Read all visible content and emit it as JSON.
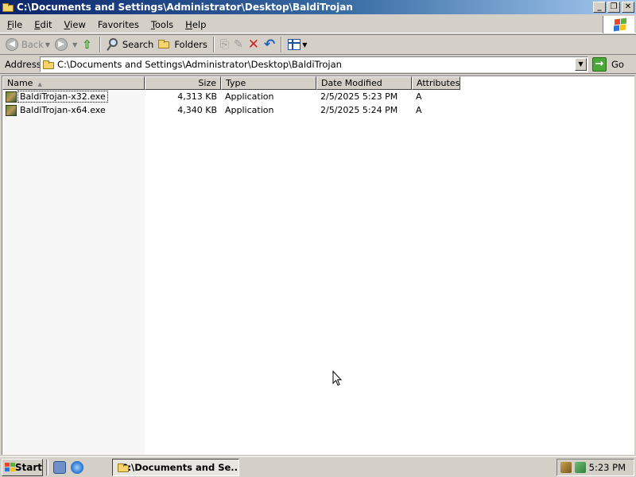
{
  "window": {
    "title": "C:\\Documents and Settings\\Administrator\\Desktop\\BaldiTrojan",
    "buttons": {
      "minimize": "_",
      "restore": "❐",
      "close": "✕"
    }
  },
  "menubar": {
    "items": [
      {
        "label": "File",
        "accel": "F",
        "rest": "ile"
      },
      {
        "label": "Edit",
        "accel": "E",
        "rest": "dit"
      },
      {
        "label": "View",
        "accel": "V",
        "rest": "iew"
      },
      {
        "label": "Favorites",
        "accel": "F",
        "rest": "avorites"
      },
      {
        "label": "Tools",
        "accel": "T",
        "rest": "ools"
      },
      {
        "label": "Help",
        "accel": "H",
        "rest": "elp"
      }
    ]
  },
  "toolbar": {
    "back_label": "Back",
    "search_label": "Search",
    "folders_label": "Folders"
  },
  "address": {
    "label": "Address",
    "value": "C:\\Documents and Settings\\Administrator\\Desktop\\BaldiTrojan",
    "go_label": "Go"
  },
  "listview": {
    "columns": [
      {
        "label": "Name"
      },
      {
        "label": "Size"
      },
      {
        "label": "Type"
      },
      {
        "label": "Date Modified"
      },
      {
        "label": "Attributes"
      }
    ],
    "rows": [
      {
        "name": "BaldiTrojan-x32.exe",
        "size": "4,313 KB",
        "type": "Application",
        "date": "2/5/2025 5:23 PM",
        "attributes": "A"
      },
      {
        "name": "BaldiTrojan-x64.exe",
        "size": "4,340 KB",
        "type": "Application",
        "date": "2/5/2025 5:24 PM",
        "attributes": "A"
      }
    ]
  },
  "taskbar": {
    "start_label": "Start",
    "task_label": "C:\\Documents and Se...",
    "clock": "5:23 PM"
  },
  "colors": {
    "titlebar_start": "#0a246a",
    "titlebar_end": "#a6caf0",
    "face": "#d4d0c8"
  }
}
